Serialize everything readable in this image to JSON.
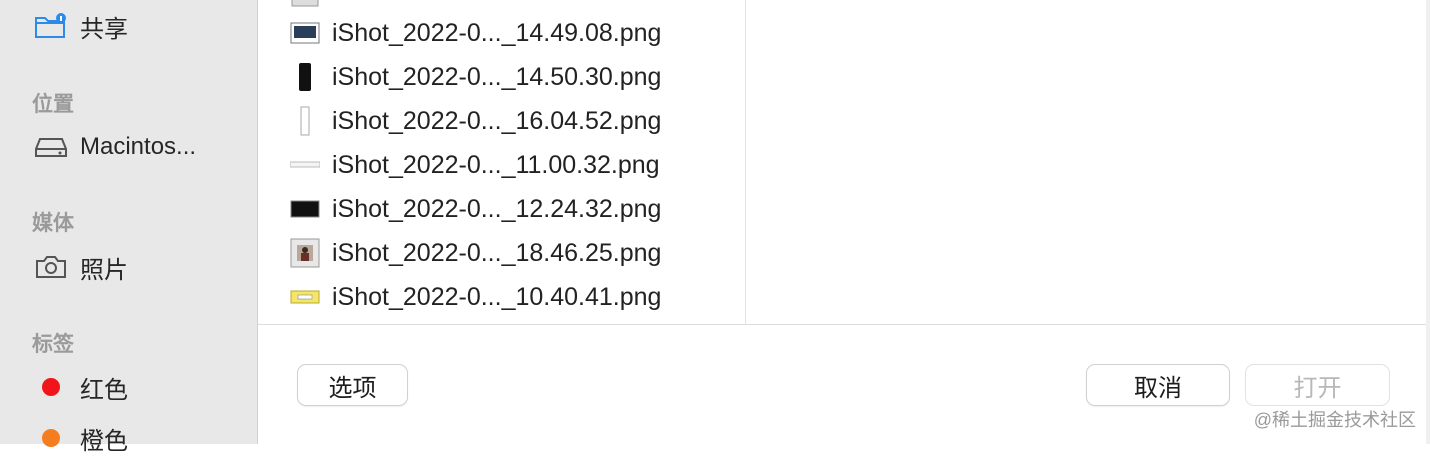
{
  "sidebar": {
    "shared_label": "共享",
    "sections": {
      "locations": "位置",
      "media": "媒体",
      "tags": "标签"
    },
    "location_item": "Macintos...",
    "media_item": "照片",
    "tags": [
      {
        "label": "红色",
        "color": "#f2141b"
      },
      {
        "label": "橙色",
        "color": "#f57d1f"
      }
    ]
  },
  "files": [
    {
      "name": "iShot_2022-0..._14.49.08.png",
      "thumb": "monitor-thumb-icon"
    },
    {
      "name": "iShot_2022-0..._14.50.30.png",
      "thumb": "phone-thumb-icon"
    },
    {
      "name": "iShot_2022-0..._16.04.52.png",
      "thumb": "tall-thumb-icon"
    },
    {
      "name": "iShot_2022-0..._11.00.32.png",
      "thumb": "wide-thumb-icon"
    },
    {
      "name": "iShot_2022-0..._12.24.32.png",
      "thumb": "dark-thumb-icon"
    },
    {
      "name": "iShot_2022-0..._18.46.25.png",
      "thumb": "photo-thumb-icon"
    },
    {
      "name": "iShot_2022-0..._10.40.41.png",
      "thumb": "yellow-thumb-icon"
    }
  ],
  "buttons": {
    "options": "选项",
    "cancel": "取消",
    "open": "打开"
  },
  "watermark": "@稀土掘金技术社区"
}
